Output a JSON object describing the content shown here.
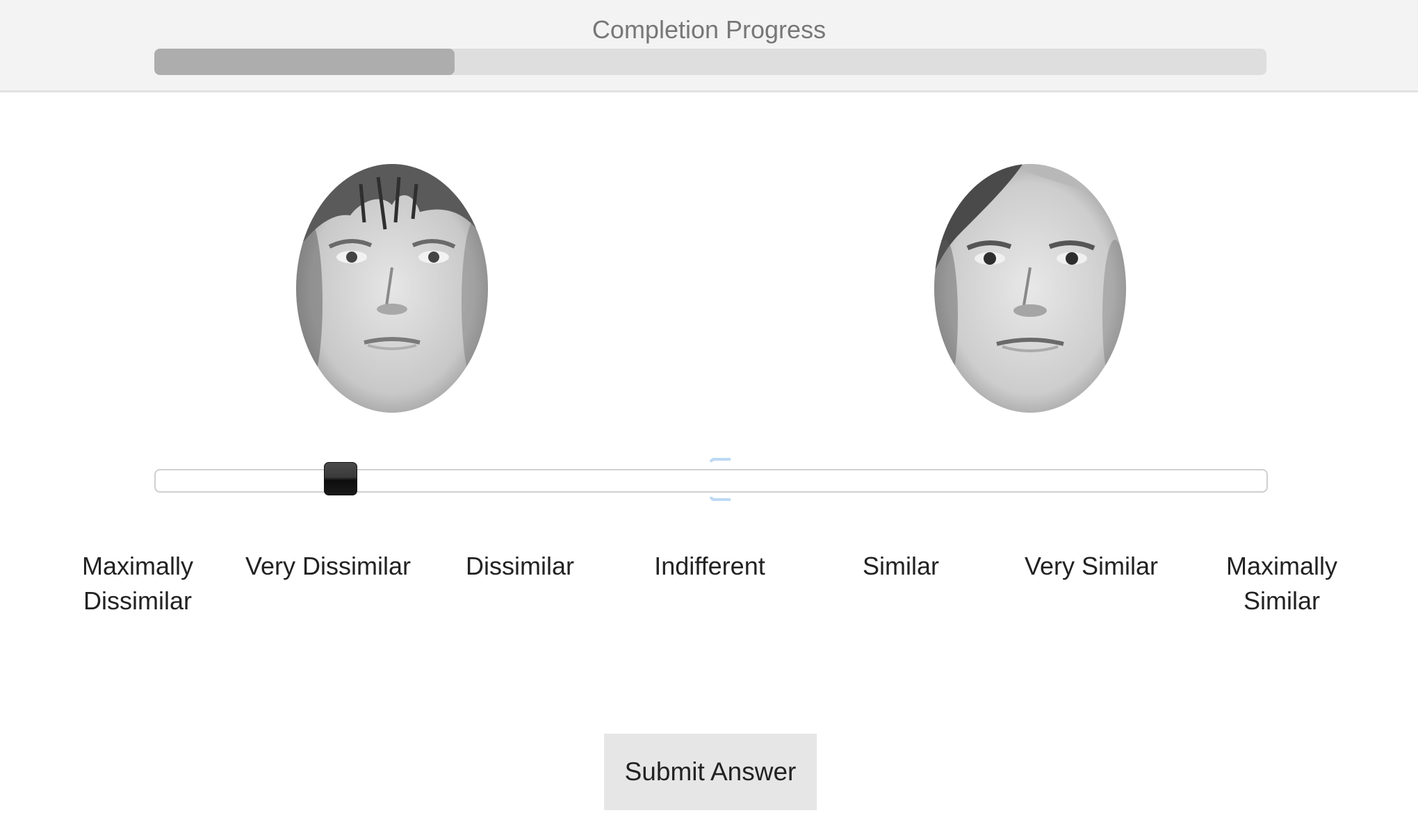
{
  "progress": {
    "title": "Completion Progress",
    "value_fraction": 0.27
  },
  "faces": {
    "left": {
      "name": "face-photo-left"
    },
    "right": {
      "name": "face-photo-right"
    }
  },
  "slider": {
    "value_fraction": 0.167,
    "min_label": "Maximally Dissimilar",
    "max_label": "Maximally Similar"
  },
  "scale_labels": [
    "Maximally Dissimilar",
    "Very Dissimilar",
    "Dissimilar",
    "Indifferent",
    "Similar",
    "Very Similar",
    "Maximally Similar"
  ],
  "submit_label": "Submit Answer",
  "colors": {
    "progress_fill": "#adadad",
    "progress_track": "#dedede",
    "handle": "#1a1a1a",
    "midmark": "#bcd9f4"
  }
}
